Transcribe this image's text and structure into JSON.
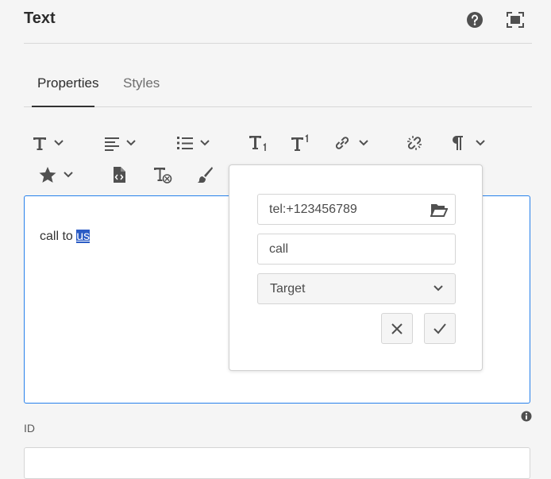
{
  "panel": {
    "title": "Text",
    "help_icon": "help-icon",
    "fullscreen_icon": "fullscreen-icon"
  },
  "tabs": [
    {
      "label": "Properties",
      "active": true
    },
    {
      "label": "Styles",
      "active": false
    }
  ],
  "toolbar": {
    "row1": [
      "text-format-icon",
      "align-icon",
      "list-icon",
      "subscript-icon",
      "superscript-icon",
      "link-icon",
      "unlink-icon",
      "paragraph-icon"
    ],
    "row2": [
      "special-char-icon",
      "source-edit-icon",
      "clear-format-icon",
      "style-brush-icon"
    ]
  },
  "editor": {
    "text_before": "call to ",
    "selected_text": "us"
  },
  "link_popover": {
    "url_value": "tel:+123456789",
    "title_value": "call",
    "target_label": "Target"
  },
  "id_field": {
    "label": "ID",
    "value": ""
  },
  "colors": {
    "accent": "#2680eb",
    "selection": "#2b5cc5",
    "icon": "#505050"
  }
}
